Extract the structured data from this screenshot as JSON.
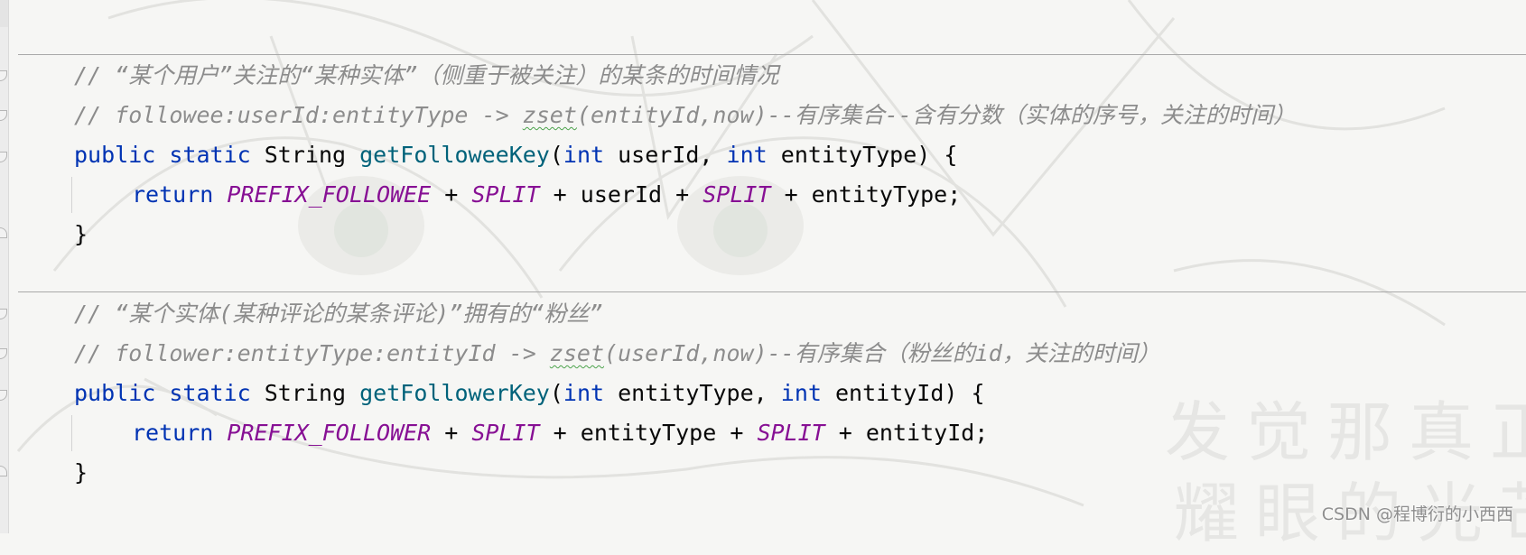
{
  "editor": {
    "block1": {
      "comment1": "// “某个用户”关注的“某种实体”（侧重于被关注）的某条的时间情况",
      "comment2_pre": "// followee:userId:entityType -> ",
      "comment2_squiggle": "zset",
      "comment2_post": "(entityId,now)--有序集合--含有分数（实体的序号，关注的时间）",
      "sig": {
        "kw_public": "public",
        "kw_static": "static",
        "type": "String",
        "method": "getFolloweeKey",
        "open": "(",
        "kw_int1": "int",
        "param1": "userId,",
        "kw_int2": "int",
        "param2": "entityType) {"
      },
      "ret": {
        "kw_return": "return",
        "const1": "PREFIX_FOLLOWEE",
        "plus1": "+",
        "const2": "SPLIT",
        "plus2": "+ userId +",
        "const3": "SPLIT",
        "tail": "+ entityType;"
      },
      "close": "}"
    },
    "block2": {
      "comment1": "// “某个实体(某种评论的某条评论)”拥有的“粉丝”",
      "comment2_pre": "// follower:entityType:entityId -> ",
      "comment2_squiggle": "zset",
      "comment2_post": "(userId,now)--有序集合（粉丝的id，关注的时间）",
      "sig": {
        "kw_public": "public",
        "kw_static": "static",
        "type": "String",
        "method": "getFollowerKey",
        "open": "(",
        "kw_int1": "int",
        "param1": "entityType,",
        "kw_int2": "int",
        "param2": "entityId) {"
      },
      "ret": {
        "kw_return": "return",
        "const1": "PREFIX_FOLLOWER",
        "plus1": "+",
        "const2": "SPLIT",
        "plus2": "+ entityType +",
        "const3": "SPLIT",
        "tail": "+ entityId;"
      },
      "close": "}"
    }
  },
  "watermark": {
    "line1": "发觉那真正",
    "line2": "耀眼的光芒",
    "credit": "CSDN @程博衍的小西西"
  },
  "colors": {
    "comment": "#8c8c8c",
    "keyword": "#0033b3",
    "method": "#00627a",
    "constant": "#871094",
    "text": "#080808",
    "background": "#f6f6f4"
  }
}
